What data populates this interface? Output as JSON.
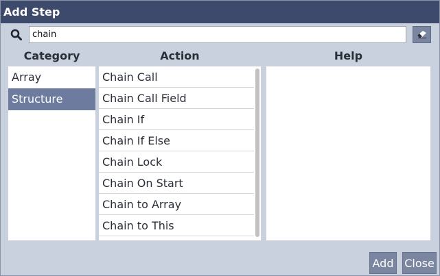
{
  "dialog": {
    "title": "Add Step"
  },
  "search": {
    "value": "chain",
    "placeholder": ""
  },
  "columns": {
    "category": "Category",
    "action": "Action",
    "help": "Help"
  },
  "categories": [
    {
      "label": "Array",
      "selected": false
    },
    {
      "label": "Structure",
      "selected": true
    }
  ],
  "actions": [
    "Chain Call",
    "Chain Call Field",
    "Chain If",
    "Chain If Else",
    "Chain Lock",
    "Chain On Start",
    "Chain to Array",
    "Chain to This"
  ],
  "buttons": {
    "add": "Add",
    "close": "Close"
  },
  "icons": {
    "search": "search-icon",
    "clear": "eraser-icon"
  },
  "colors": {
    "titlebar": "#3e4a6b",
    "dialog_bg": "#c9d1df",
    "selected_item": "#6d7c9e",
    "button": "#7a869f"
  }
}
